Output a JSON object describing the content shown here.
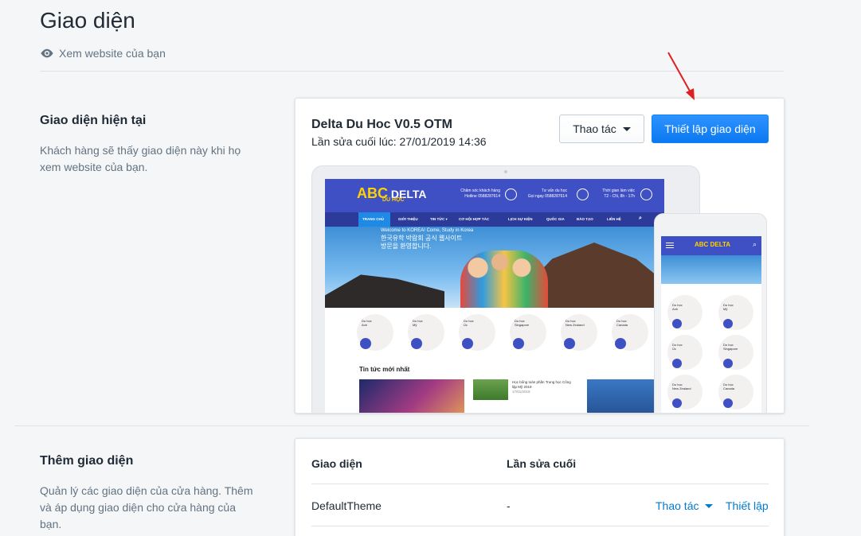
{
  "page": {
    "title": "Giao diện",
    "view_website": "Xem website của bạn"
  },
  "current_section": {
    "title": "Giao diện hiện tại",
    "description": "Khách hàng sẽ thấy giao diện này khi họ xem website của bạn."
  },
  "current_theme": {
    "name": "Delta Du Hoc V0.5 OTM",
    "last_edited": "Lần sửa cuối lúc: 27/01/2019 14:36",
    "actions_label": "Thao tác",
    "setup_label": "Thiết lập giao diện"
  },
  "preview": {
    "logo_abc": "ABC",
    "logo_text": "DELTA",
    "logo_sub": "DU HỌC",
    "header_items": [
      "Chăm sóc khách hàng\nHotline 0588287614",
      "Tư vấn du học\nGọi ngay 0588287614",
      "Thời gian làm việc\nT2 - CN, 8h - 17h"
    ],
    "nav": [
      "TRANG CHỦ",
      "GIỚI THIỆU",
      "TIN TỨC ▾",
      "CƠ HỘI HỢP TÁC",
      "LỊCH SỰ KIỆN",
      "QUỐC GIA",
      "ĐÀO TẠO",
      "LIÊN HỆ"
    ],
    "hero_text": "Welcome to KOREA! Come, Study in Korea",
    "hero_korean": "한국유학 박람회 공식 웹사이트\n방문을 환영합니다.",
    "countries": [
      "Du học\nAnh",
      "Du học\nMỹ",
      "Du học\nÚc",
      "Du học\nSingapore",
      "Du học\nNew Zealand",
      "Du học\nCanada"
    ],
    "news_title": "Tin tức mới nhất",
    "news_item": "Học bổng toàn phần Trung học Công lập Mỹ 2019",
    "news_date": "17/01/2019"
  },
  "add_section": {
    "title": "Thêm giao diện",
    "description": "Quản lý các giao diện của cửa hàng. Thêm và áp dụng giao diện cho cửa hàng của bạn."
  },
  "themes_table": {
    "headers": [
      "Giao diện",
      "Lần sửa cuối"
    ],
    "rows": [
      {
        "name": "DefaultTheme",
        "last_edited": "-",
        "actions_label": "Thao tác",
        "setup_label": "Thiết lập"
      }
    ]
  },
  "colors": {
    "primary_button": "#0b78f0",
    "link": "#007ace",
    "annotation_arrow": "#e02020"
  }
}
